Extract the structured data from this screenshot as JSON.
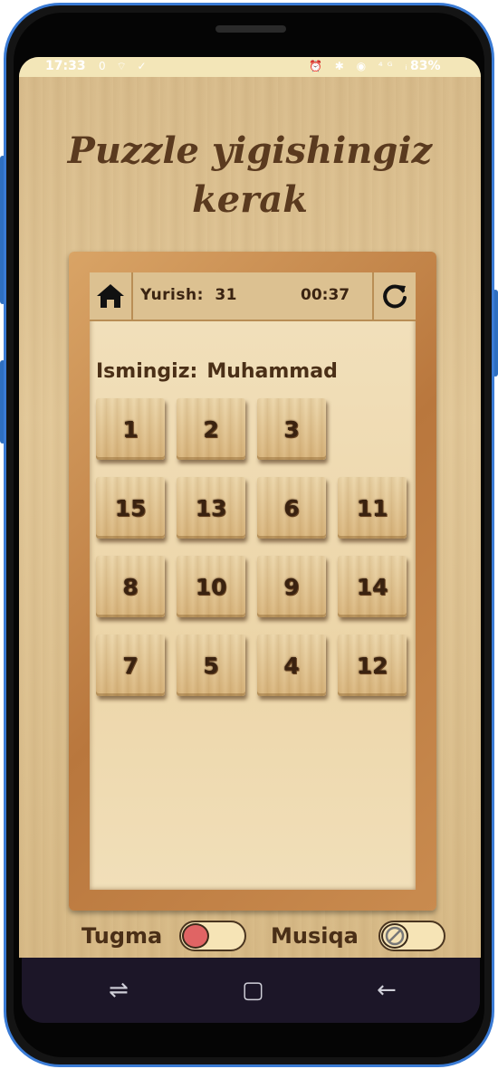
{
  "status": {
    "time": "17:33",
    "left_icons": "0 ⌔ ✓",
    "right_icons": "⏰ ✱ ◉ ⁴ᴳ ᵢₗ",
    "battery": "83%"
  },
  "title": {
    "line1": "Puzzle yigishingiz",
    "line2": "kerak"
  },
  "hud": {
    "moves_label": "Yurish:",
    "moves_value": "31",
    "timer": "00:37"
  },
  "player": {
    "label": "Ismingiz:",
    "name": "Muhammad"
  },
  "board": {
    "rows": 4,
    "cols": 4,
    "tiles": [
      [
        "1",
        "2",
        "3",
        ""
      ],
      [
        "15",
        "13",
        "6",
        "11"
      ],
      [
        "8",
        "10",
        "9",
        "14"
      ],
      [
        "7",
        "5",
        "4",
        "12"
      ]
    ]
  },
  "toggles": {
    "button_label": "Tugma",
    "button_on": true,
    "music_label": "Musiqa",
    "music_on": false
  },
  "colors": {
    "wood_text": "#4a2f17",
    "toggle_knob_on": "#e06464",
    "phone_accent": "#3a7bd5"
  },
  "icons": {
    "home": "home-icon",
    "reload": "reload-icon",
    "recent": "recent-apps-icon",
    "home_nav": "home-nav-icon",
    "back": "back-icon"
  },
  "nav": {
    "recent": "⇌",
    "home": "▢",
    "back": "←"
  }
}
